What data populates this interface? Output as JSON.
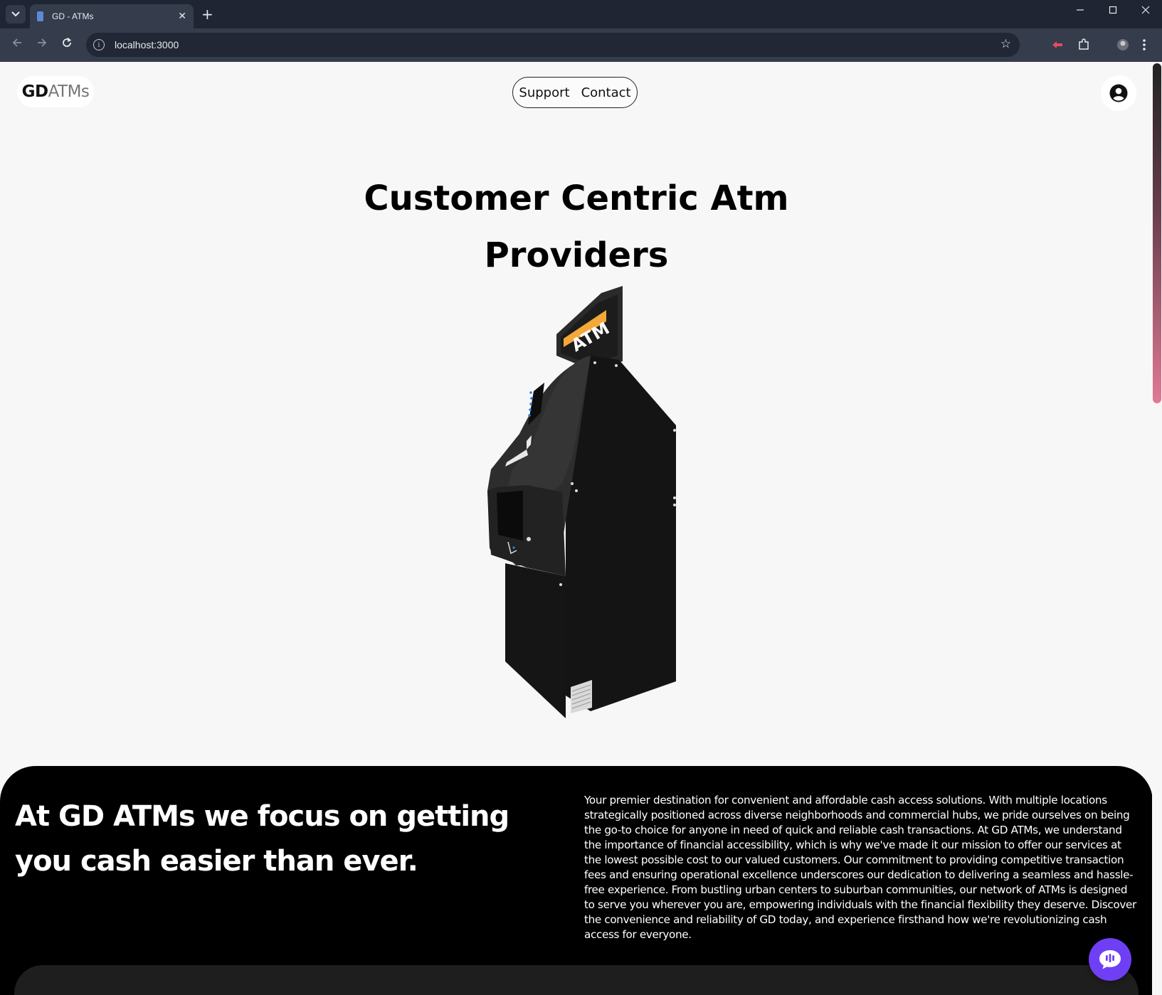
{
  "browser": {
    "tab_title": "GD - ATMs",
    "url": "localhost:3000"
  },
  "header": {
    "logo_bold": "GD",
    "logo_light": "ATMs",
    "nav": [
      "Support",
      "Contact"
    ]
  },
  "hero": {
    "title_line1": "Customer Centric Atm",
    "title_line2": "Providers",
    "atm_sign": "ATM"
  },
  "about": {
    "tagline": "At GD ATMs we focus on getting you cash easier than ever.",
    "body": "Your premier destination for convenient and affordable cash access solutions. With multiple locations strategically positioned across diverse neighborhoods and commercial hubs, we pride ourselves on being the go-to choice for anyone in need of quick and reliable cash transactions. At GD ATMs, we understand the importance of financial accessibility, which is why we've made it our mission to offer our services at the lowest possible cost to our valued customers. Our commitment to providing competitive transaction fees and ensuring operational excellence underscores our dedication to delivering a seamless and hassle-free experience. From bustling urban centers to suburban communities, our network of ATMs is designed to serve you wherever you are, empowering individuals with the financial flexibility they deserve. Discover the convenience and reliability of GD today, and experience firsthand how we're revolutionizing cash access for everyone."
  },
  "colors": {
    "page_bg": "#f7f7f7",
    "dark_section": "#000000",
    "chat_button": "#6f3ff5",
    "atm_sign": "#f4a83a"
  },
  "icons": [
    "chevron-down-icon",
    "close-icon",
    "plus-icon",
    "minimize-icon",
    "maximize-icon",
    "back-icon",
    "forward-icon",
    "reload-icon",
    "info-icon",
    "star-icon",
    "extensions-icon",
    "profile-icon",
    "menu-icon",
    "account-icon",
    "chat-icon"
  ]
}
